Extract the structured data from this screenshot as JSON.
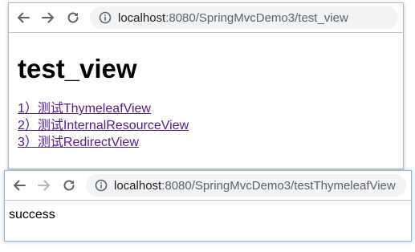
{
  "window1": {
    "url_host": "localhost",
    "url_rest": ":8080/SpringMvcDemo3/test_view",
    "page_title": "test_view",
    "links": [
      {
        "label": "1）测试ThymeleafView"
      },
      {
        "label": "2）测试InternalResourceView"
      },
      {
        "label": "3）测试RedirectView"
      }
    ],
    "link_color": "#551a8b"
  },
  "window2": {
    "url_host": "localhost",
    "url_rest": ":8080/SpringMvcDemo3/testThymeleafView",
    "body_text": "success"
  },
  "icons": {
    "back": "back-arrow-icon",
    "forward": "forward-arrow-icon",
    "reload": "reload-icon",
    "info": "info-icon"
  },
  "colors": {
    "omnibox_bg": "#f1f3f4",
    "focus_border": "#8fb7dd"
  }
}
